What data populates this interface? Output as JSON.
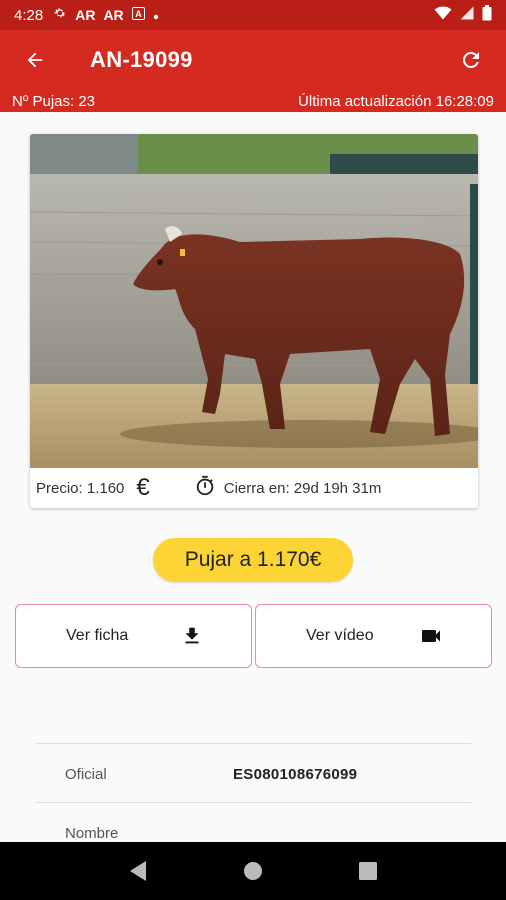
{
  "status_bar": {
    "time": "4:28",
    "notification_icons": [
      "gear-icon",
      "ar-icon",
      "ar-icon",
      "a-icon",
      "dot-icon"
    ],
    "right_icons": [
      "wifi-icon",
      "signal-icon",
      "battery-icon"
    ]
  },
  "app_bar": {
    "title": "AN-19099"
  },
  "sub_bar": {
    "bids": "Nº Pujas: 23",
    "last_update": "Última actualización 16:28:09"
  },
  "lot_card": {
    "price": "Precio: 1.160",
    "currency_symbol": "€",
    "closes_in": "Cierra en: 29d 19h 31m"
  },
  "bid_button": {
    "label": "Pujar a 1.170€"
  },
  "actions": {
    "ficha_label": "Ver ficha",
    "video_label": "Ver vídeo"
  },
  "details": {
    "rows": [
      {
        "label": "Oficial",
        "value": "ES080108676099"
      }
    ],
    "cut_off_label": "Nombre"
  },
  "colors": {
    "status_bar": "#b91f17",
    "app_bar": "#d42a1f",
    "bid_button": "#fcd535",
    "button_border": "#e88a9a"
  }
}
